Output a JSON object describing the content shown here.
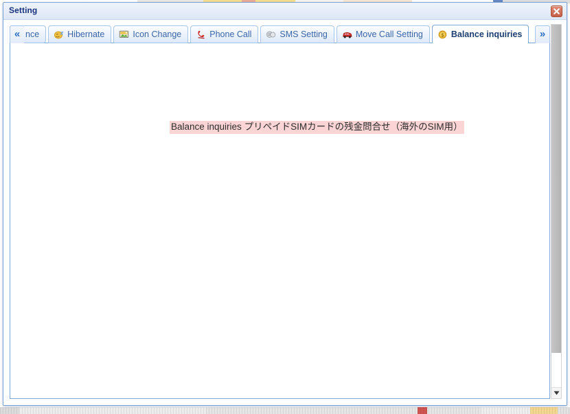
{
  "window": {
    "title": "Setting",
    "close_label": "Close",
    "close_icon": "close-x-icon"
  },
  "tabs": {
    "scroll_left_glyph": "«",
    "scroll_right_glyph": "»",
    "scroll_left_name": "scroll-tabs-left",
    "scroll_right_name": "scroll-tabs-right",
    "items": [
      {
        "label": "nce",
        "icon": "partial-tab-icon",
        "active": false,
        "clipped": true
      },
      {
        "label": "Hibernate",
        "icon": "sleep-face-icon",
        "active": false,
        "clipped": false
      },
      {
        "label": "Icon Change",
        "icon": "picture-icon",
        "active": false,
        "clipped": false
      },
      {
        "label": "Phone Call",
        "icon": "red-telephone-icon",
        "active": false,
        "clipped": false
      },
      {
        "label": "SMS Setting",
        "icon": "silver-sms-icon",
        "active": false,
        "clipped": false
      },
      {
        "label": "Move Call Setting",
        "icon": "red-car-icon",
        "active": false,
        "clipped": false
      },
      {
        "label": "Balance inquiries",
        "icon": "gold-coin-icon",
        "active": true,
        "clipped": false
      }
    ]
  },
  "content": {
    "description": "Balance inquiries プリペイドSIMカードの残金問合せ（海外のSIM用）",
    "highlight_color": "#fbd5d5",
    "text_color": "#2d2d2d"
  },
  "scrollbar": {
    "down_glyph": "▼",
    "thumb_name": "scroll-thumb"
  },
  "colors": {
    "title_text": "#17327c",
    "window_border": "#7da3d4",
    "tab_border": "#a8c4e6",
    "active_tab_text": "#1c3f72",
    "inactive_tab_text": "#3a66a8",
    "close_button": "#d3725c"
  }
}
